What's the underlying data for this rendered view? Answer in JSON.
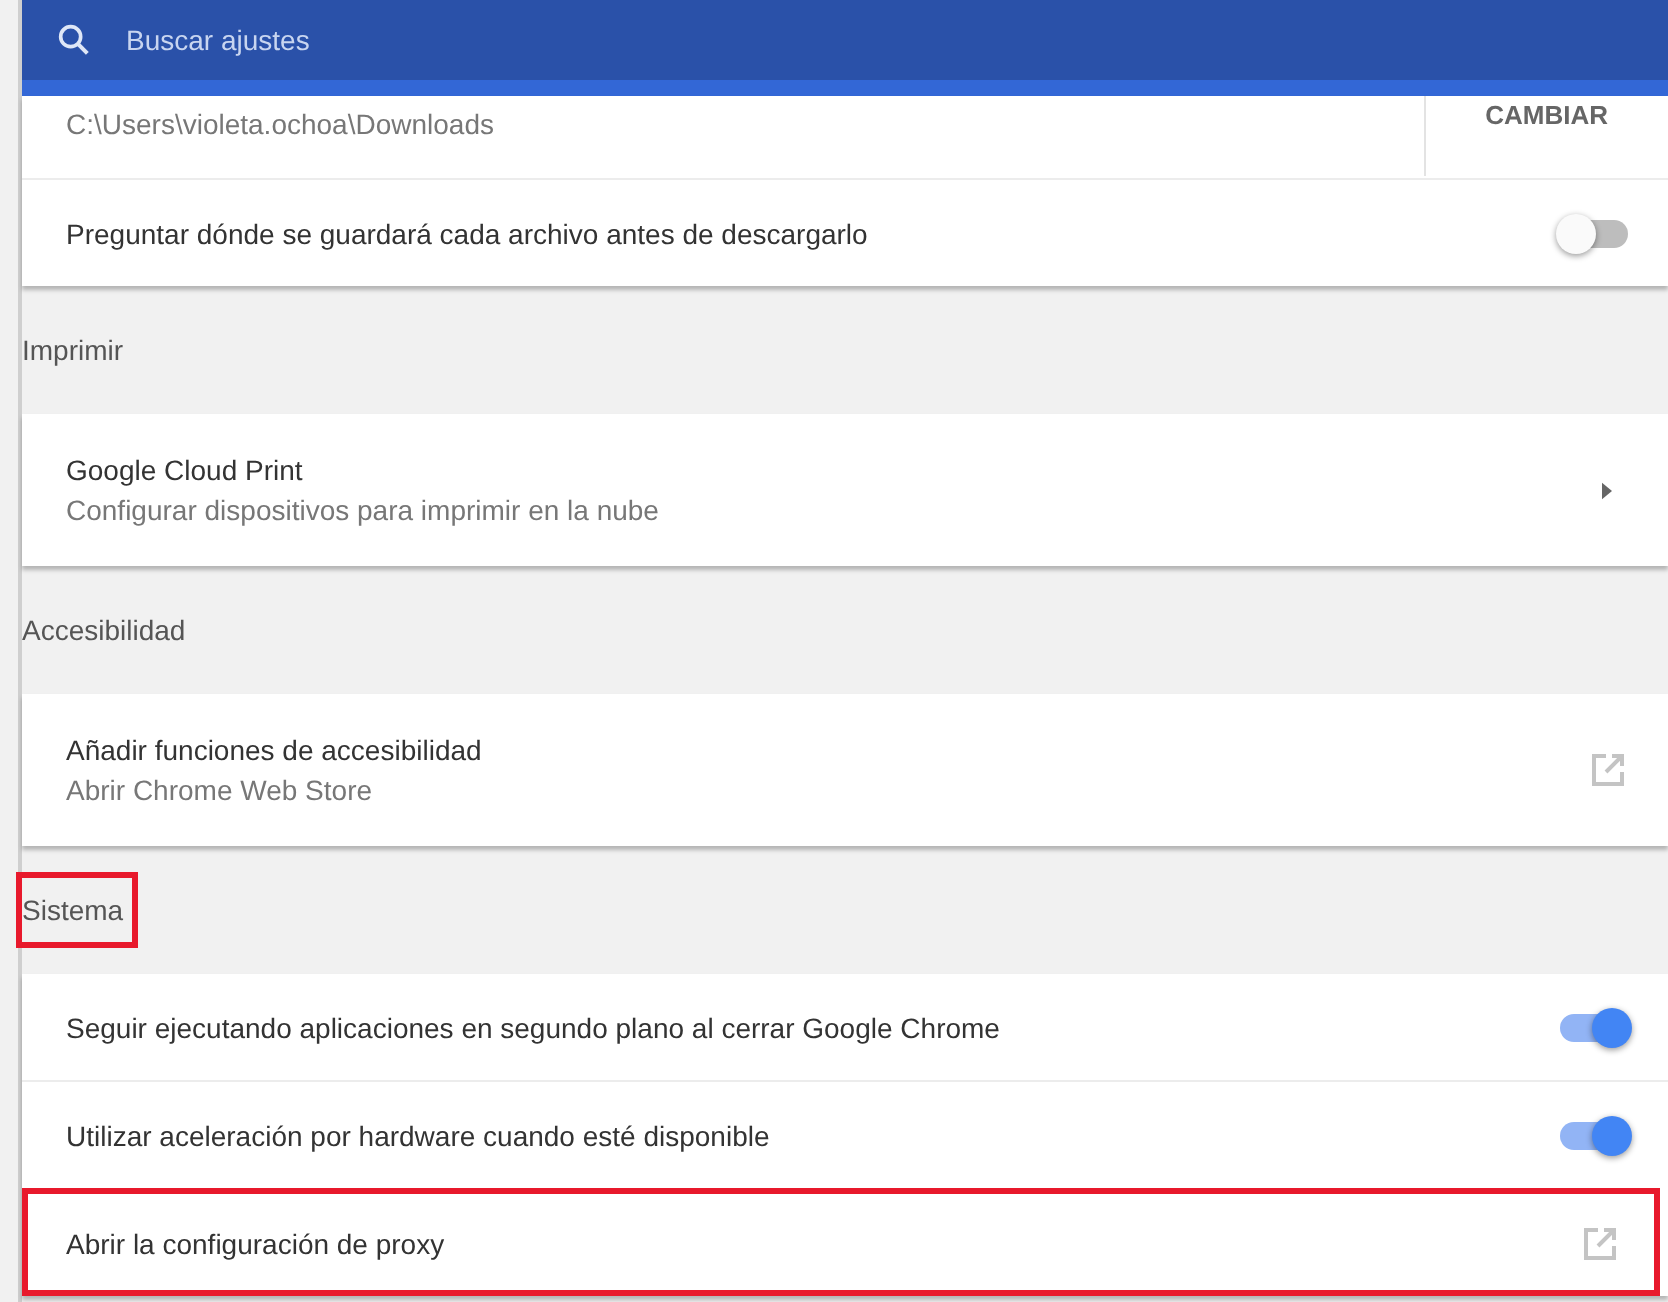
{
  "search": {
    "placeholder": "Buscar ajustes"
  },
  "sections": [
    {
      "rows": [
        {
          "kind": "path",
          "value": "C:\\Users\\violeta.ochoa\\Downloads",
          "button": "CAMBIAR",
          "highlighted": false
        },
        {
          "kind": "toggle",
          "label": "Preguntar dónde se guardará cada archivo antes de descargarlo",
          "on": false,
          "highlighted": false
        }
      ]
    },
    {
      "title": "Imprimir",
      "highlighted": false,
      "rows": [
        {
          "kind": "subpage",
          "label": "Google Cloud Print",
          "sublabel": "Configurar dispositivos para imprimir en la nube",
          "highlighted": false
        }
      ]
    },
    {
      "title": "Accesibilidad",
      "highlighted": false,
      "rows": [
        {
          "kind": "external",
          "label": "Añadir funciones de accesibilidad",
          "sublabel": "Abrir Chrome Web Store",
          "highlighted": false
        }
      ]
    },
    {
      "title": "Sistema",
      "highlighted": true,
      "rows": [
        {
          "kind": "toggle",
          "label": "Seguir ejecutando aplicaciones en segundo plano al cerrar Google Chrome",
          "on": true,
          "highlighted": false
        },
        {
          "kind": "toggle",
          "label": "Utilizar aceleración por hardware cuando esté disponible",
          "on": true,
          "highlighted": false
        },
        {
          "kind": "external",
          "label": "Abrir la configuración de proxy",
          "highlighted": true
        }
      ]
    }
  ]
}
